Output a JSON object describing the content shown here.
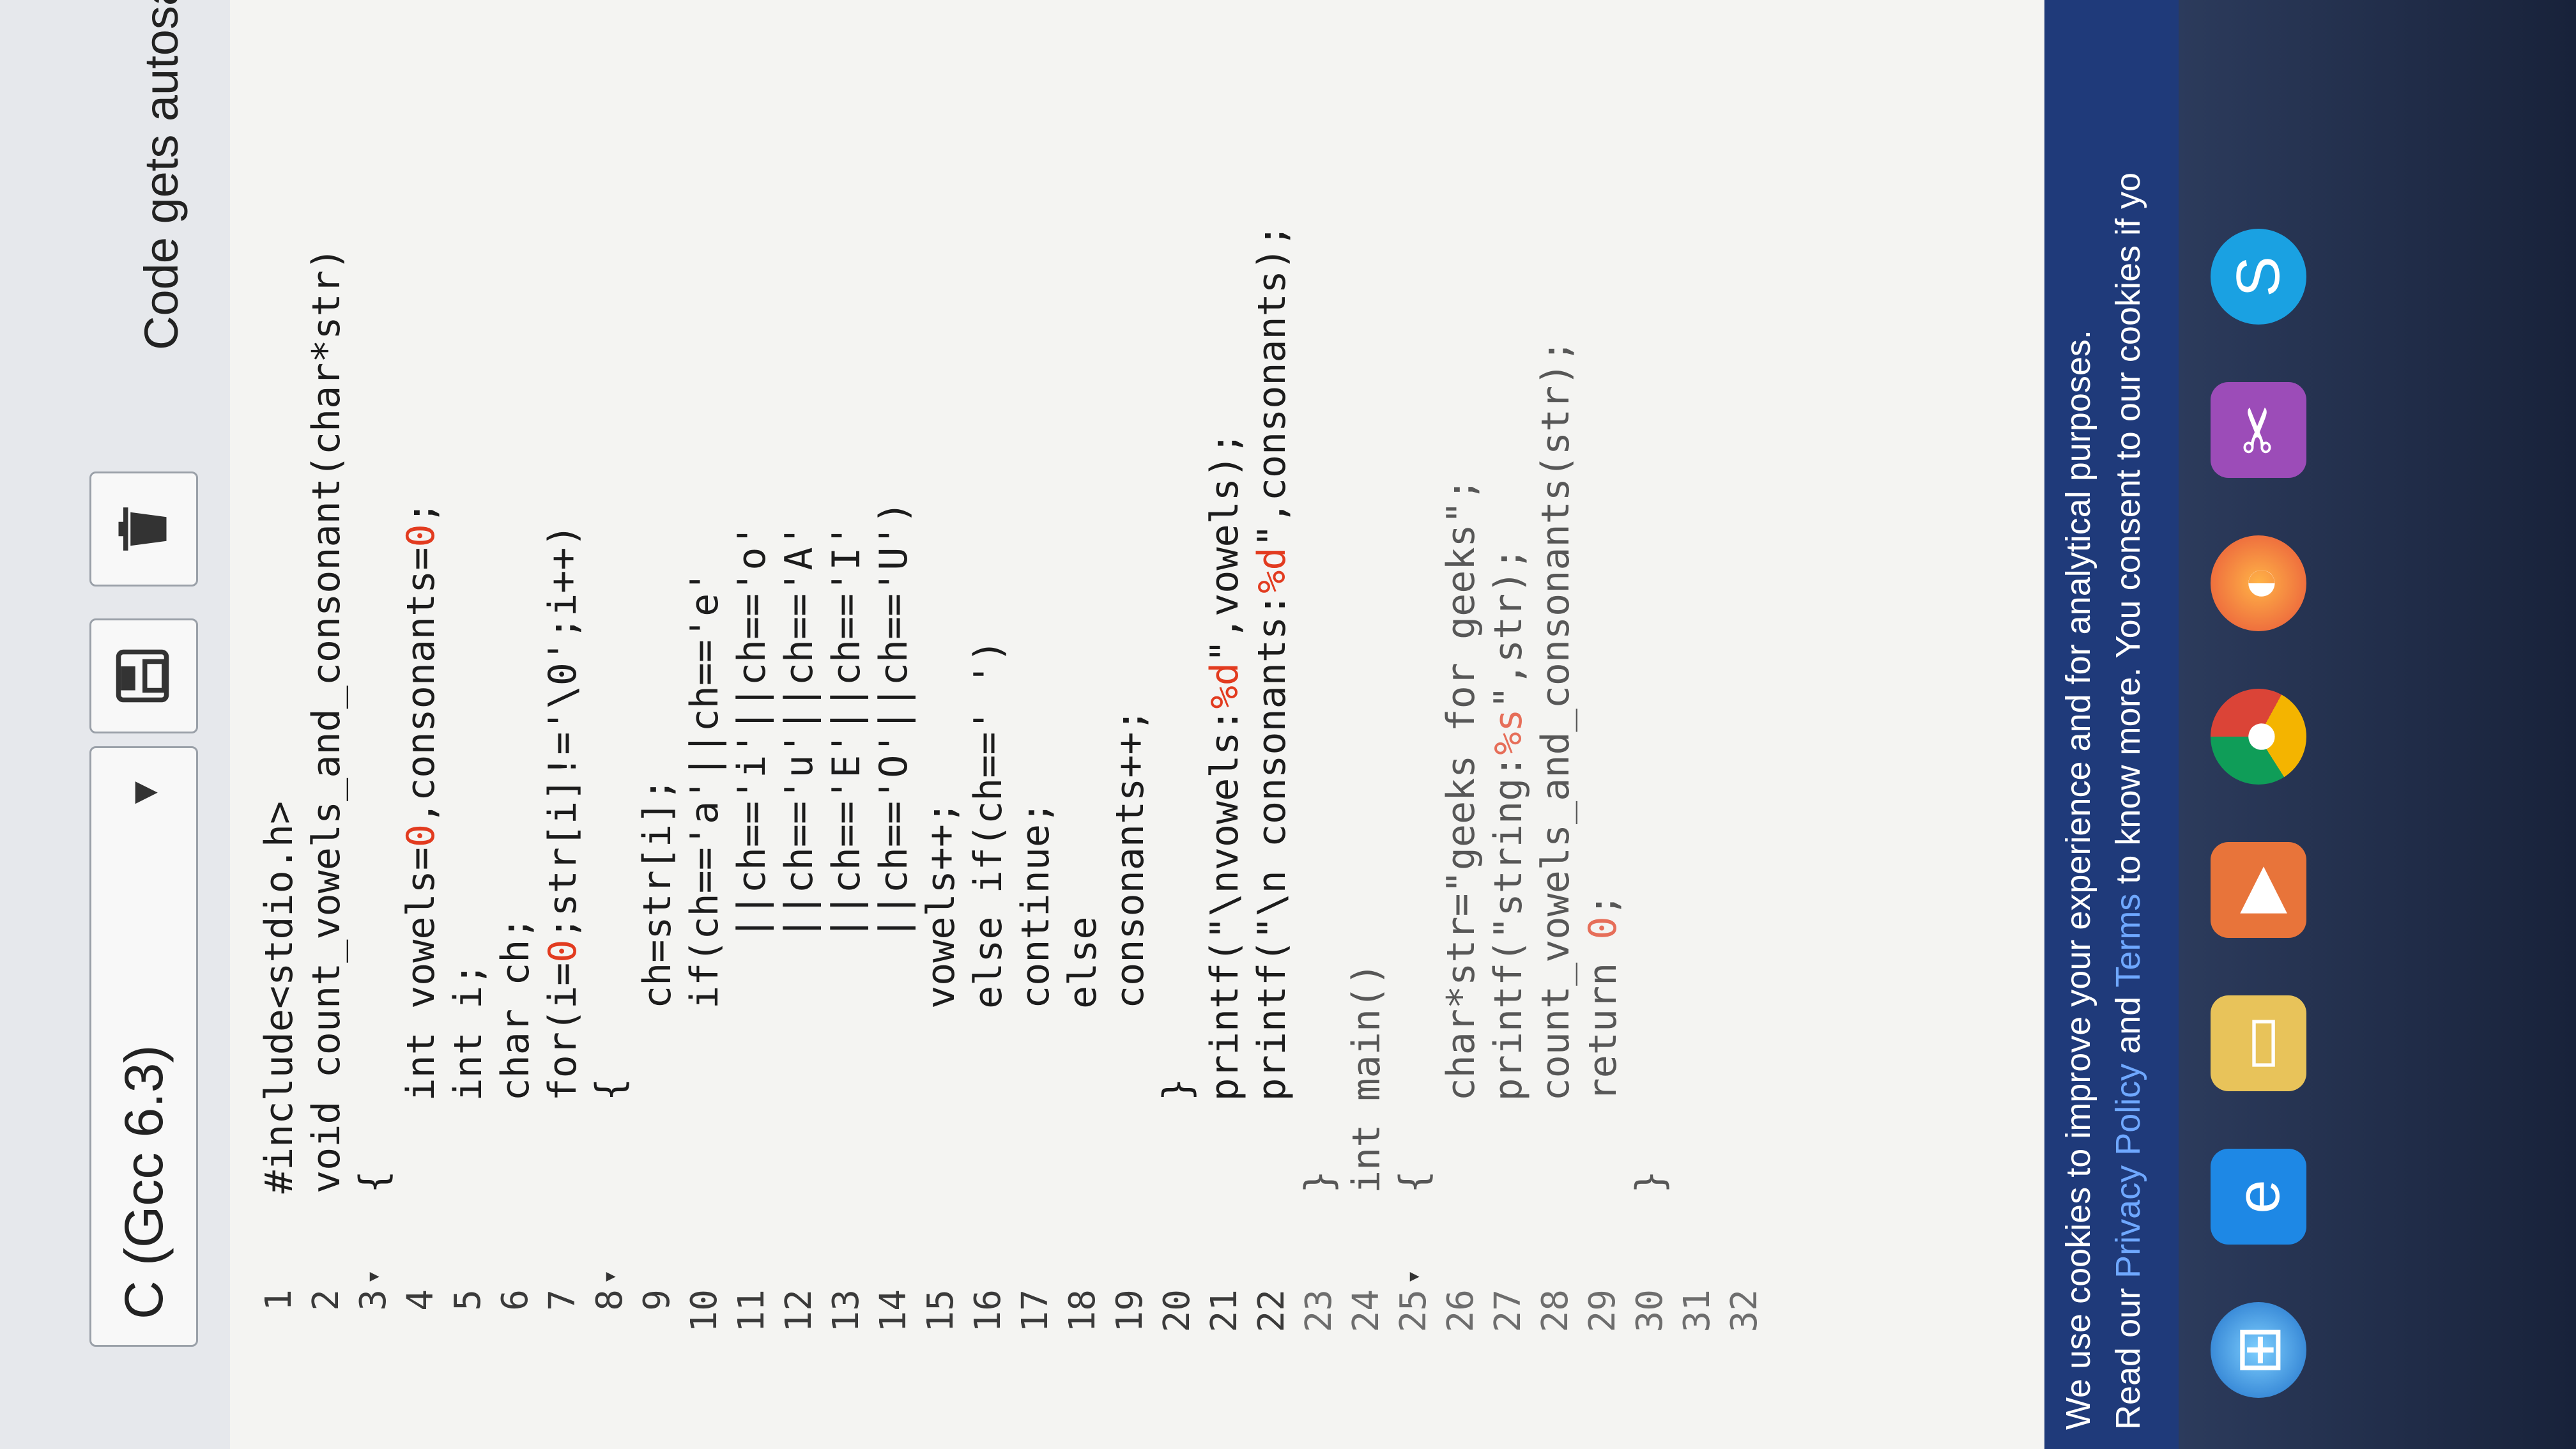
{
  "toolbar": {
    "language_label": "C (Gcc 6.3)",
    "save_icon": "save-icon",
    "delete_icon": "trash-icon",
    "autosave_note": "Code gets autosaved"
  },
  "editor": {
    "line_numbers": [
      "1",
      "2",
      "3",
      "4",
      "5",
      "6",
      "7",
      "8",
      "9",
      "10",
      "11",
      "12",
      "13",
      "14",
      "15",
      "16",
      "17",
      "18",
      "19",
      "20",
      "21",
      "22",
      "23",
      "24",
      "25",
      "26",
      "27",
      "28",
      "29",
      "30",
      "31",
      "32"
    ],
    "lines": [
      "#include<stdio.h>",
      "void count_vowels_and_consonant(char*str)",
      "{",
      "    int vowels=0,consonants=0;",
      "    int i;",
      "    char ch;",
      "    for(i=0;str[i]!='\\0';i++)",
      "    {",
      "        ch=str[i];",
      "        if(ch=='a'||ch=='e'",
      "           ||ch=='i'||ch=='o'",
      "           ||ch=='u'||ch=='A'",
      "           ||ch=='E'||ch=='I'",
      "           ||ch=='O'||ch=='U')",
      "        vowels++;",
      "        else if(ch==' ')",
      "        continue;",
      "        else",
      "        consonants++;",
      "    }",
      "    printf(\"\\nvowels:%d\",vowels);",
      "    printf(\"\\n consonants:%d\",consonants);",
      "}",
      "int main()",
      "{",
      "    char*str=\"geeks for geeks\";",
      "    printf(\"string:%s\",str);",
      "    count_vowels_and_consonants(str);",
      "    return 0;",
      "}",
      "",
      ""
    ],
    "fold_markers": {
      "3": "▾",
      "8": "▾",
      "25": "▾"
    }
  },
  "cookie_banner": {
    "line1": "We use cookies to improve your experience and for analytical purposes.",
    "line2_prefix": "Read our ",
    "privacy_link": "Privacy Policy",
    "line2_mid": " and ",
    "terms_link": "Terms",
    "line2_suffix": " to know more. You consent to our cookies if yo"
  },
  "taskbar": {
    "icons": [
      "windows-start-icon",
      "internet-explorer-icon",
      "file-explorer-icon",
      "media-player-icon",
      "chrome-icon",
      "firefox-icon",
      "snipping-tool-icon",
      "skype-icon"
    ]
  },
  "colors": {
    "number_literal": "#e23b1f",
    "banner_bg": "#1f3a7a",
    "banner_link": "#6fa8ff"
  }
}
